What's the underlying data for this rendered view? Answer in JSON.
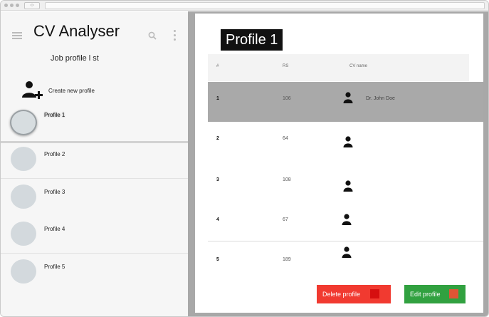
{
  "app": {
    "title": "CV Analyser"
  },
  "sidebar": {
    "heading": "Job profile l st",
    "create_label": "Create new profile",
    "profiles": [
      {
        "name": "Profile 1",
        "selected": true
      },
      {
        "name": "Profile 2",
        "selected": false
      },
      {
        "name": "Profile 3",
        "selected": false
      },
      {
        "name": "Profile 4",
        "selected": false
      },
      {
        "name": "Profile 5",
        "selected": false
      }
    ]
  },
  "main": {
    "profile_title": "Profile 1",
    "table": {
      "columns": [
        "#",
        "RS",
        "CV name"
      ],
      "rows": [
        {
          "rank": "1",
          "score": "106",
          "cv_name": "Dr. John Doe",
          "selected": true
        },
        {
          "rank": "2",
          "score": "64",
          "cv_name": "",
          "selected": false
        },
        {
          "rank": "3",
          "score": "108",
          "cv_name": "",
          "selected": false
        },
        {
          "rank": "4",
          "score": "67",
          "cv_name": "",
          "selected": false
        },
        {
          "rank": "5",
          "score": "189",
          "cv_name": "",
          "selected": false
        }
      ]
    },
    "actions": {
      "delete_label": "Delete profile",
      "edit_label": "Edit profile"
    }
  },
  "colors": {
    "delete": "#f13a30",
    "edit": "#31a140",
    "selected_row": "#a9a9a9",
    "title_bg": "#111111"
  }
}
